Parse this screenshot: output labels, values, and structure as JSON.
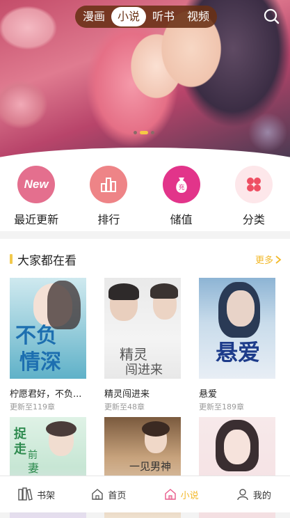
{
  "top_tabs": [
    {
      "label": "漫画",
      "active": false
    },
    {
      "label": "小说",
      "active": true
    },
    {
      "label": "听书",
      "active": false
    },
    {
      "label": "视频",
      "active": false
    }
  ],
  "banner": {
    "slide_count": 3,
    "current_slide": 1
  },
  "categories": [
    {
      "label": "最近更新",
      "icon": "new-icon",
      "color": "#e46f8e",
      "icon_text": "New"
    },
    {
      "label": "排行",
      "icon": "ranking-icon",
      "color": "#ee8487"
    },
    {
      "label": "储值",
      "icon": "money-bag-icon",
      "color": "#e2348a",
      "icon_text": "充"
    },
    {
      "label": "分类",
      "icon": "category-icon",
      "color": "#ee4f63"
    }
  ],
  "section": {
    "title": "大家都在看",
    "more_label": "更多"
  },
  "books": [
    {
      "title": "柠愿君好，不负...",
      "subtitle": "更新至119章",
      "cover_text": [
        "不负",
        "情深"
      ]
    },
    {
      "title": "精灵闯进来",
      "subtitle": "更新至48章",
      "cover_text": [
        "精灵",
        "闯进来"
      ]
    },
    {
      "title": "悬爱",
      "subtitle": "更新至189章",
      "cover_text": [
        "悬爱"
      ]
    },
    {
      "title": "",
      "subtitle": "",
      "cover_text": [
        "捉",
        "走",
        "前",
        "妻"
      ]
    },
    {
      "title": "",
      "subtitle": "",
      "cover_text": [
        "一见男神"
      ]
    },
    {
      "title": "",
      "subtitle": "",
      "cover_text": []
    }
  ],
  "bottom_tabs": [
    {
      "label": "书架",
      "icon": "bookshelf-icon",
      "active": false
    },
    {
      "label": "首页",
      "icon": "home-icon",
      "active": false
    },
    {
      "label": "小说",
      "icon": "novel-icon",
      "active": true
    },
    {
      "label": "我的",
      "icon": "profile-icon",
      "active": false
    }
  ],
  "colors": {
    "accent": "#f3b92b",
    "nav_bg": "#69301a"
  }
}
